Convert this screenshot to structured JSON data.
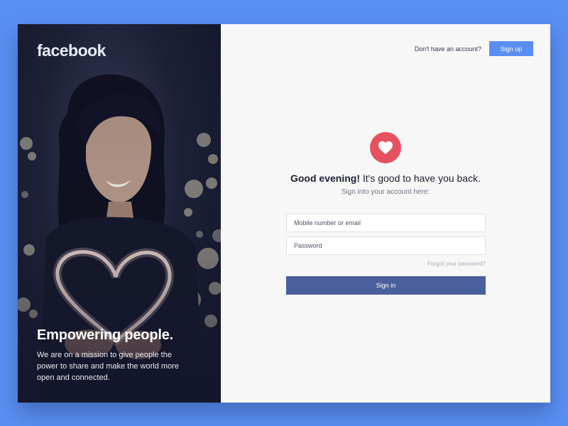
{
  "brand": {
    "logo_text": "facebook"
  },
  "hero": {
    "title": "Empowering people.",
    "text": "We are on a mission to give people the power to share and make the world more open and connected."
  },
  "header": {
    "question": "Don't have an account?",
    "signup_label": "Sign up"
  },
  "login": {
    "icon": "heart-icon",
    "greeting_bold": "Good evening!",
    "greeting_rest": " It's good to have you back.",
    "subtitle": "Sign into your account here:",
    "email_placeholder": "Mobile number or email",
    "password_placeholder": "Password",
    "forgot_label": "Forgot your password?",
    "signin_label": "Sign in"
  },
  "colors": {
    "background": "#5a8ff2",
    "signup_button": "#5b8ef2",
    "heart_badge": "#e5525f",
    "signin_button": "#4a5f9b"
  }
}
